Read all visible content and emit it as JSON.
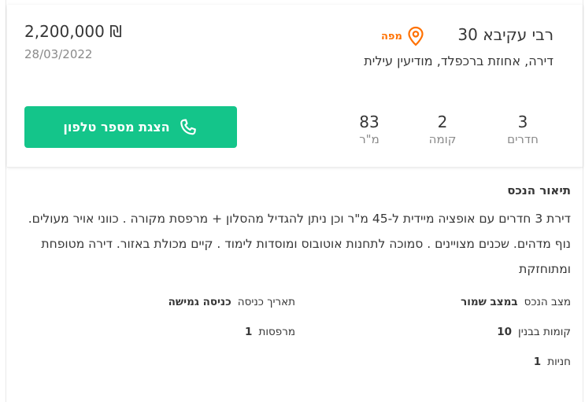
{
  "listing": {
    "address": "רבי עקיבא 30",
    "map_label": "מפה",
    "subtitle": "דירה, אחוזת ברכפלד, מודיעין עילית",
    "price": "2,200,000 ₪",
    "date": "28/03/2022",
    "phone_button_label": "הצגת מספר טלפון",
    "stats": [
      {
        "value": "3",
        "label": "חדרים"
      },
      {
        "value": "2",
        "label": "קומה"
      },
      {
        "value": "83",
        "label": "מ\"ר"
      }
    ]
  },
  "description": {
    "title": "תיאור הנכס",
    "text": "דירת 3 חדרים עם אופציה מיידית ל-45 מ\"ר וכן ניתן להגדיל מהסלון + מרפסת מקורה . כווני אויר מעולים. נוף מדהים. שכנים מצויינים . סמוכה לתחנות אוטובוס ומוסדות לימוד . קיים מכולת באזור. דירה מטופחת ומתוחזקת"
  },
  "details": [
    {
      "label": "מצב הנכס",
      "value": "במצב שמור"
    },
    {
      "label": "תאריך כניסה",
      "value": "כניסה גמישה"
    },
    {
      "label": "קומות בבנין",
      "value": "10"
    },
    {
      "label": "מרפסות",
      "value": "1"
    },
    {
      "label": "חניות",
      "value": "1"
    }
  ],
  "colors": {
    "accent_orange": "#ff7100",
    "button_green": "#14c58a",
    "text": "#363636",
    "muted": "#8a8a8a"
  },
  "icons": {
    "map": "map-pin-icon",
    "phone": "phone-icon"
  }
}
